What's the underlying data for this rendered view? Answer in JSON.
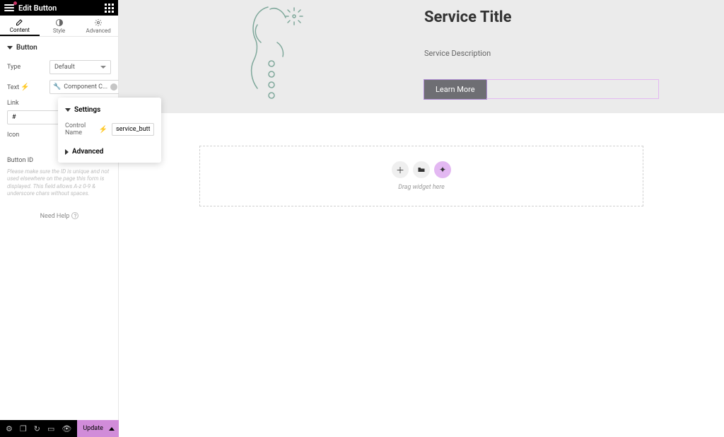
{
  "panel": {
    "title": "Edit Button",
    "tabs": {
      "content": "Content",
      "style": "Style",
      "advanced": "Advanced"
    },
    "section": "Button",
    "type_label": "Type",
    "type_value": "Default",
    "text_label": "Text",
    "text_value": "Component C...",
    "link_label": "Link",
    "link_value": "#",
    "icon_label": "Icon",
    "buttonid_label": "Button ID",
    "id_help": "Please make sure the ID is unique and not used elsewhere on the page this form is displayed. This field allows A-z 0-9 & underscore chars without spaces.",
    "need_help": "Need Help",
    "update": "Update"
  },
  "popover": {
    "settings": "Settings",
    "control_name_label": "Control Name",
    "control_name_value": "service_button",
    "advanced": "Advanced"
  },
  "hero": {
    "title": "Service Title",
    "desc": "Service Description",
    "button": "Learn More"
  },
  "drop": {
    "label": "Drag widget here"
  }
}
